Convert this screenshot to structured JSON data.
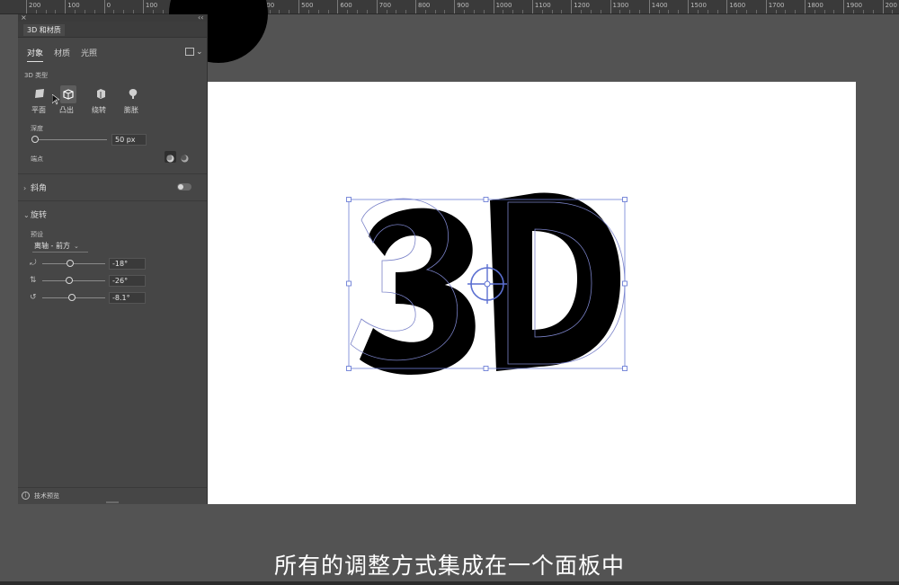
{
  "ruler": {
    "labels": [
      "200",
      "100",
      "0",
      "100",
      "200",
      "300",
      "400",
      "500",
      "600",
      "700",
      "800",
      "900",
      "1000",
      "1100",
      "1200",
      "1300",
      "1400",
      "1500",
      "1600",
      "1700",
      "1800",
      "1900",
      "200"
    ]
  },
  "panel": {
    "title": "3D 和材质",
    "tabs": [
      {
        "label": "对象",
        "active": true
      },
      {
        "label": "材质",
        "active": false
      },
      {
        "label": "光照",
        "active": false
      }
    ],
    "type_section_label": "3D 类型",
    "types": [
      {
        "label": "平面",
        "icon": "plane-icon",
        "active": false
      },
      {
        "label": "凸出",
        "icon": "extrude-icon",
        "active": true
      },
      {
        "label": "绕转",
        "icon": "revolve-icon",
        "active": false
      },
      {
        "label": "膨胀",
        "icon": "inflate-icon",
        "active": false
      }
    ],
    "depth_label": "深度",
    "depth_value": "50 px",
    "depth_level": 0.0,
    "cap_label": "端点",
    "bevel_label": "斜角",
    "bevel_enabled": false,
    "rotation_label": "旋转",
    "preset_label": "预设",
    "preset_value": "离轴 - 前方",
    "rotations": [
      {
        "icon": "rotate-x-icon",
        "value": "-18°"
      },
      {
        "icon": "rotate-y-icon",
        "value": "-26°"
      },
      {
        "icon": "rotate-z-icon",
        "value": "-8.1°"
      }
    ],
    "footer_label": "技术预览"
  },
  "artwork": {
    "text": "3D"
  },
  "subtitle": "所有的调整方式集成在一个面板中",
  "colors": {
    "app_bg": "#535353",
    "panel_bg": "#464646",
    "selection": "#5b6fd1"
  }
}
